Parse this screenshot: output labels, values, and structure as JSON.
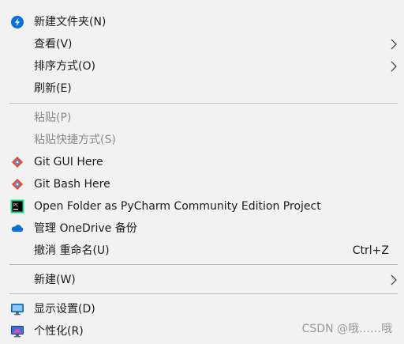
{
  "menu": {
    "items": [
      {
        "label": "新建文件夹(N)",
        "icon": "new-folder-onedrive-icon"
      },
      {
        "label": "查看(V)",
        "submenu": true
      },
      {
        "label": "排序方式(O)",
        "submenu": true
      },
      {
        "label": "刷新(E)"
      },
      {
        "label": "粘贴(P)",
        "disabled": true
      },
      {
        "label": "粘贴快捷方式(S)",
        "disabled": true
      },
      {
        "label": "Git GUI Here",
        "icon": "git-icon"
      },
      {
        "label": "Git Bash Here",
        "icon": "git-icon"
      },
      {
        "label": "Open Folder as PyCharm Community Edition Project",
        "icon": "pycharm-icon"
      },
      {
        "label": "管理 OneDrive 备份",
        "icon": "onedrive-cloud-icon"
      },
      {
        "label": "撤消 重命名(U)",
        "shortcut": "Ctrl+Z"
      },
      {
        "label": "新建(W)",
        "submenu": true
      },
      {
        "label": "显示设置(D)",
        "icon": "display-settings-icon"
      },
      {
        "label": "个性化(R)",
        "icon": "personalize-icon"
      }
    ]
  },
  "watermark": "CSDN @哦……哦",
  "colors": {
    "menu_bg": "#f2f2f2",
    "separator": "#bdbdbd",
    "disabled_text": "#8a8a8a",
    "accent_blue": "#0a6fd6",
    "git_red": "#e94e31",
    "pycharm_green": "#21d789"
  }
}
